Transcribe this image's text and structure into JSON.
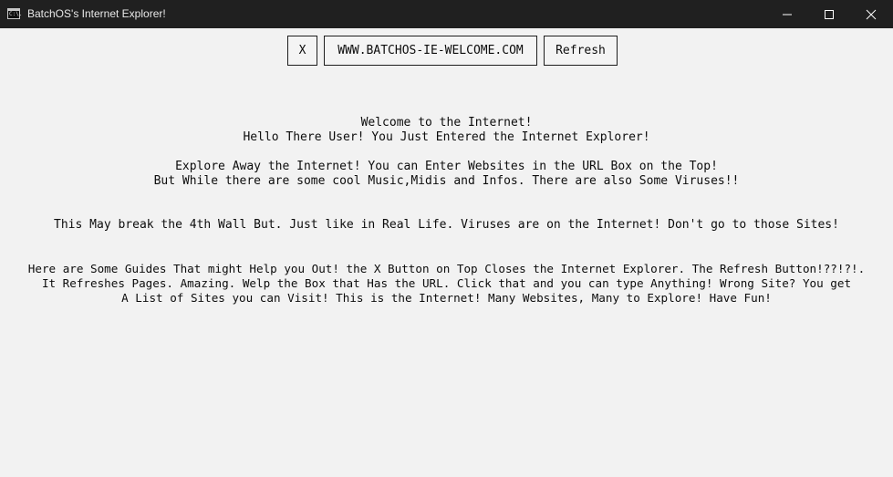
{
  "window": {
    "title": "BatchOS's Internet Explorer!",
    "icon": "console-app-icon",
    "icon_text": "C:\\."
  },
  "toolbar": {
    "close_label": "X",
    "url_value": "WWW.BATCHOS-IE-WELCOME.COM",
    "refresh_label": "Refresh"
  },
  "page": {
    "lines": [
      "Welcome to the Internet!",
      "Hello There User! You Just Entered the Internet Explorer!",
      "Explore Away the Internet! You can Enter Websites in the URL Box on the Top!",
      "But While there are some cool Music,Midis and Infos. There are also Some Viruses!!",
      "This May break the 4th Wall But. Just like in Real Life. Viruses are on the Internet! Don't go to those Sites!",
      "Here are Some Guides That might Help you Out! the X Button on Top Closes the Internet Explorer. The Refresh Button!??!?!.",
      "It Refreshes Pages. Amazing. Welp the Box that Has the URL. Click that and you can type Anything! Wrong Site? You get",
      "A List of Sites you can Visit! This is the Internet! Many Websites, Many to Explore! Have Fun!"
    ]
  },
  "colors": {
    "titlebar_bg": "#202020",
    "content_bg": "#f2f2f2",
    "text": "#0c0c0c",
    "border": "#1e1e1e"
  }
}
